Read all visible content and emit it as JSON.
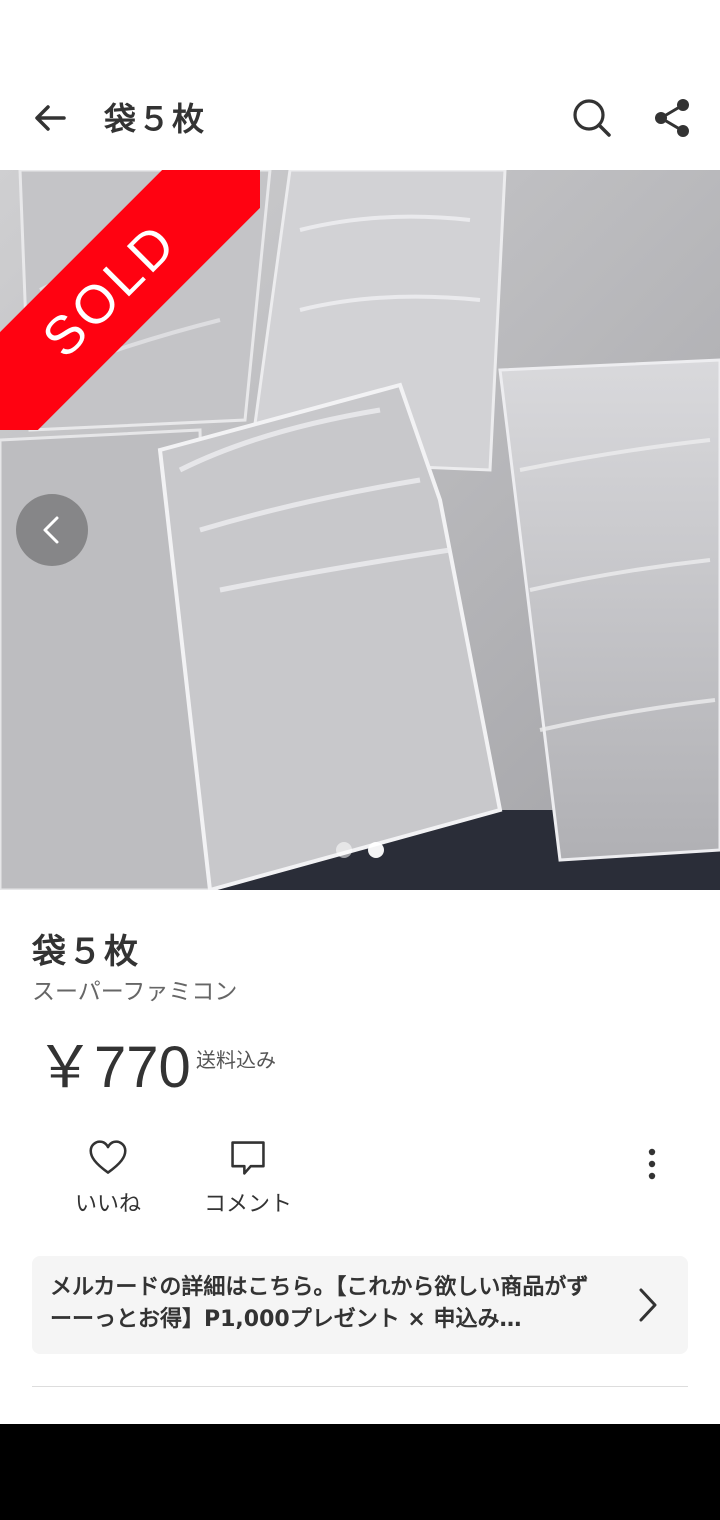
{
  "header": {
    "title": "袋５枚",
    "back_icon": "arrow-left-icon",
    "search_icon": "search-icon",
    "share_icon": "share-icon"
  },
  "photo": {
    "sold_label": "SOLD",
    "sold_color": "#ff0211",
    "prev_icon": "chevron-left-icon",
    "page_count": 2,
    "current_page": 2
  },
  "item": {
    "title": "袋５枚",
    "category": "スーパーファミコン",
    "price": "￥770",
    "shipping": "送料込み"
  },
  "actions": {
    "like_label": "いいね",
    "comment_label": "コメント",
    "more_icon": "more-vertical-icon"
  },
  "banner": {
    "text": "メルカードの詳細はこちら。【これから欲しい商品がずーーっとお得】P1,000プレゼント × 申込み…",
    "chevron_icon": "chevron-right-icon"
  }
}
